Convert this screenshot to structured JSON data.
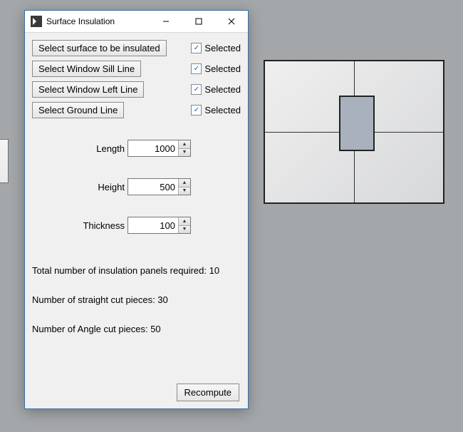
{
  "window": {
    "title": "Surface Insulation"
  },
  "selectors": [
    {
      "label": "Select surface to be insulated",
      "status": "Selected",
      "checked": true
    },
    {
      "label": "Select Window Sill Line",
      "status": "Selected",
      "checked": true
    },
    {
      "label": "Select Window Left Line",
      "status": "Selected",
      "checked": true
    },
    {
      "label": "Select Ground Line",
      "status": "Selected",
      "checked": true
    }
  ],
  "inputs": {
    "length": {
      "label": "Length",
      "value": "1000"
    },
    "height": {
      "label": "Height",
      "value": "500"
    },
    "thickness": {
      "label": "Thickness",
      "value": "100"
    }
  },
  "results": {
    "total_panels": "Total number of insulation panels required: 10",
    "straight_pieces": "Number of straight cut pieces: 30",
    "angle_pieces": "Number of Angle cut pieces: 50"
  },
  "buttons": {
    "recompute": "Recompute"
  }
}
